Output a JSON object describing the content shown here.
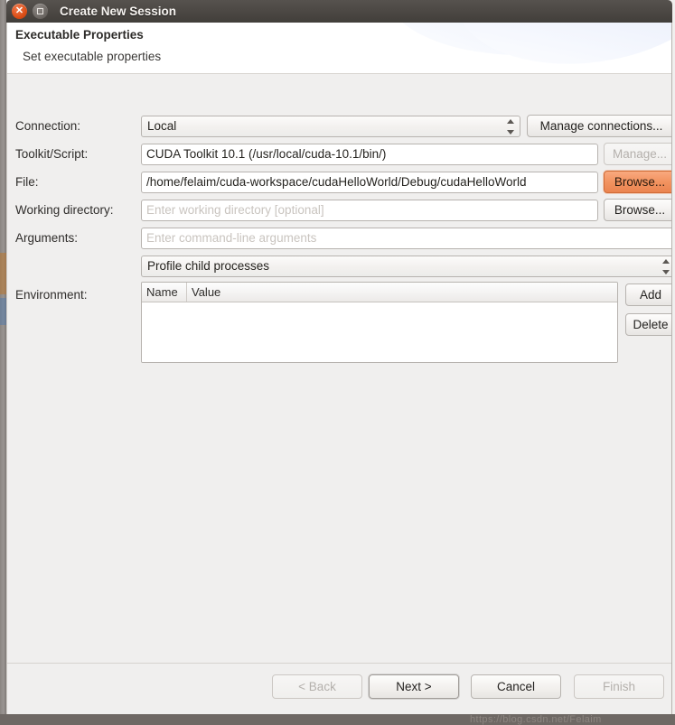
{
  "window": {
    "title": "Create New Session",
    "close_icon": "close-icon",
    "maximize_icon": "maximize-icon"
  },
  "wizard": {
    "title": "Executable Properties",
    "subtitle": "Set executable properties"
  },
  "form": {
    "connection": {
      "label": "Connection:",
      "value": "Local",
      "manage_button": "Manage connections..."
    },
    "toolkit": {
      "label": "Toolkit/Script:",
      "value": "CUDA Toolkit 10.1 (/usr/local/cuda-10.1/bin/)",
      "manage_button": "Manage..."
    },
    "file": {
      "label": "File:",
      "value": "/home/felaim/cuda-workspace/cudaHelloWorld/Debug/cudaHelloWorld",
      "browse_button": "Browse..."
    },
    "working_directory": {
      "label": "Working directory:",
      "value": "",
      "placeholder": "Enter working directory [optional]",
      "browse_button": "Browse..."
    },
    "arguments": {
      "label": "Arguments:",
      "value": "",
      "placeholder": "Enter command-line arguments"
    },
    "child_processes": {
      "value": "Profile child processes"
    },
    "environment": {
      "label": "Environment:",
      "columns": [
        "Name",
        "Value"
      ],
      "rows": [],
      "add_button": "Add",
      "delete_button": "Delete"
    }
  },
  "footer": {
    "back_button": "< Back",
    "next_button": "Next >",
    "cancel_button": "Cancel",
    "finish_button": "Finish"
  },
  "watermark": "https://blog.csdn.net/Felaim",
  "colors": {
    "accent_focus": "#f29360",
    "titlebar": "#4b4743",
    "background": "#f0efee",
    "close_button": "#da4d16"
  }
}
